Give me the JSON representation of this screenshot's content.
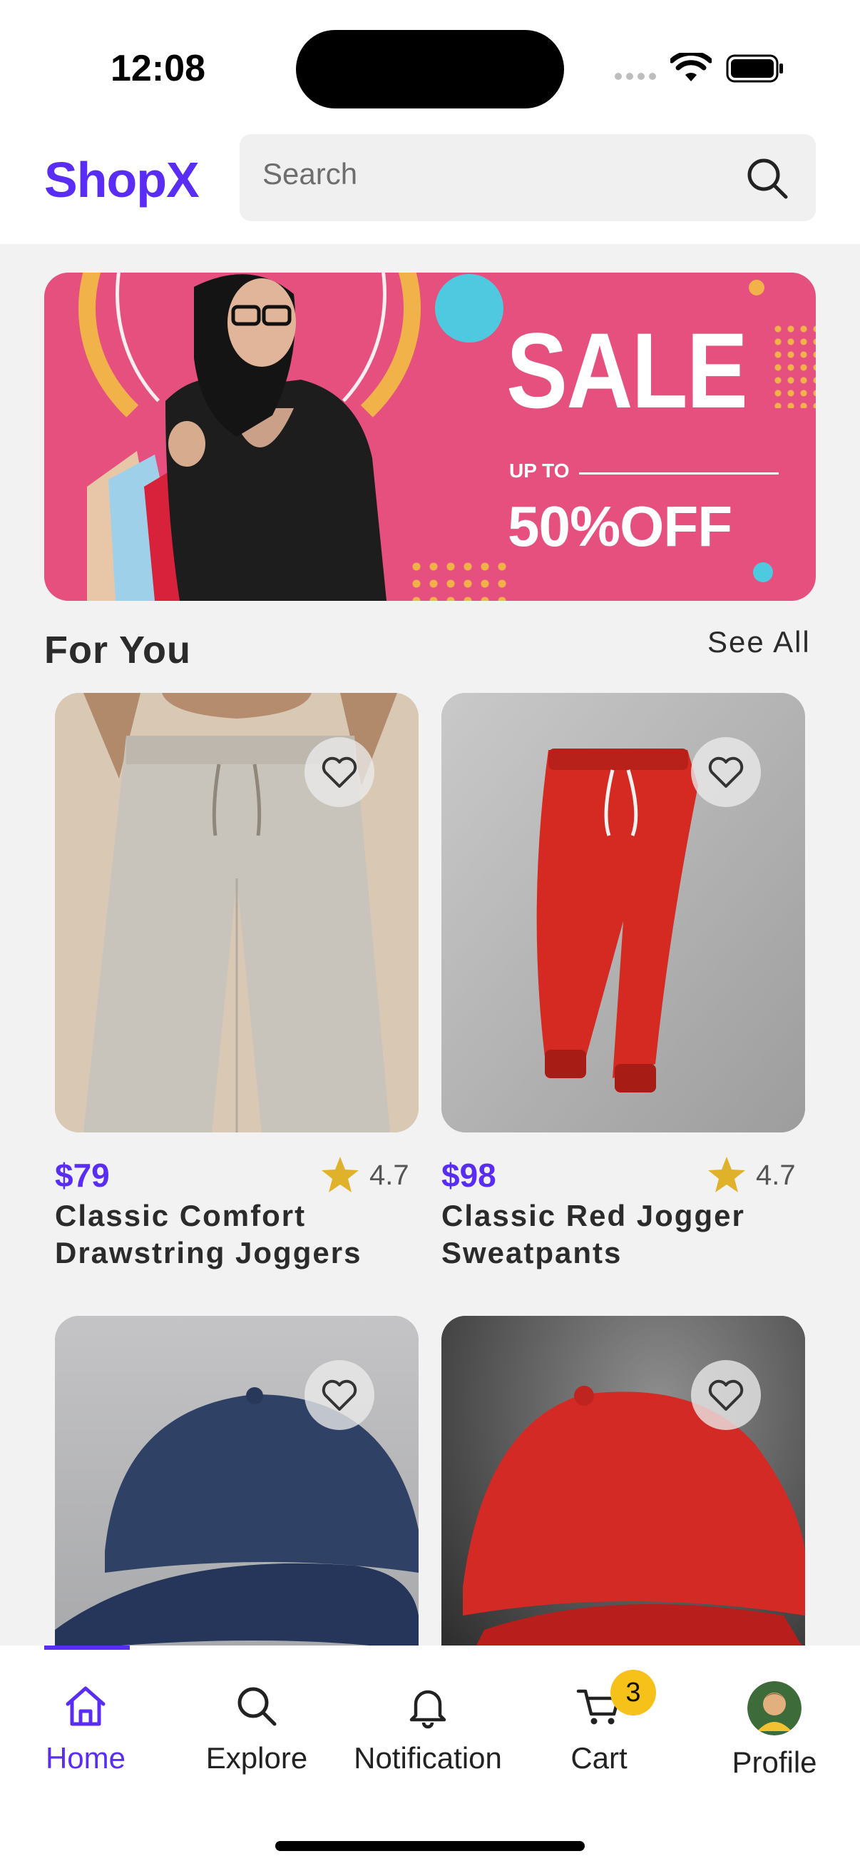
{
  "status_bar": {
    "time": "12:08"
  },
  "header": {
    "brand": "ShopX",
    "search_placeholder": "Search"
  },
  "banner": {
    "title": "SALE",
    "subtitle": "UP TO",
    "discount": "50%OFF"
  },
  "section": {
    "title": "For You",
    "see_all": "See All"
  },
  "products": [
    {
      "price": "$79",
      "rating": "4.7",
      "name_line1": "Classic Comfort",
      "name_line2": "Drawstring Joggers"
    },
    {
      "price": "$98",
      "rating": "4.7",
      "name_line1": "Classic Red Jogger",
      "name_line2": "Sweatpants"
    },
    {
      "price": "",
      "rating": "",
      "name_line1": "",
      "name_line2": ""
    },
    {
      "price": "",
      "rating": "",
      "name_line1": "",
      "name_line2": ""
    }
  ],
  "tabs": [
    {
      "label": "Home",
      "icon": "home-icon",
      "active": true
    },
    {
      "label": "Explore",
      "icon": "search-icon"
    },
    {
      "label": "Notification",
      "icon": "bell-icon"
    },
    {
      "label": "Cart",
      "icon": "cart-icon",
      "badge": "3"
    },
    {
      "label": "Profile",
      "icon": "avatar"
    }
  ],
  "colors": {
    "accent": "#5a2df5",
    "banner": "#e5507f",
    "star": "#e0b12a",
    "badge": "#f6c21a"
  }
}
